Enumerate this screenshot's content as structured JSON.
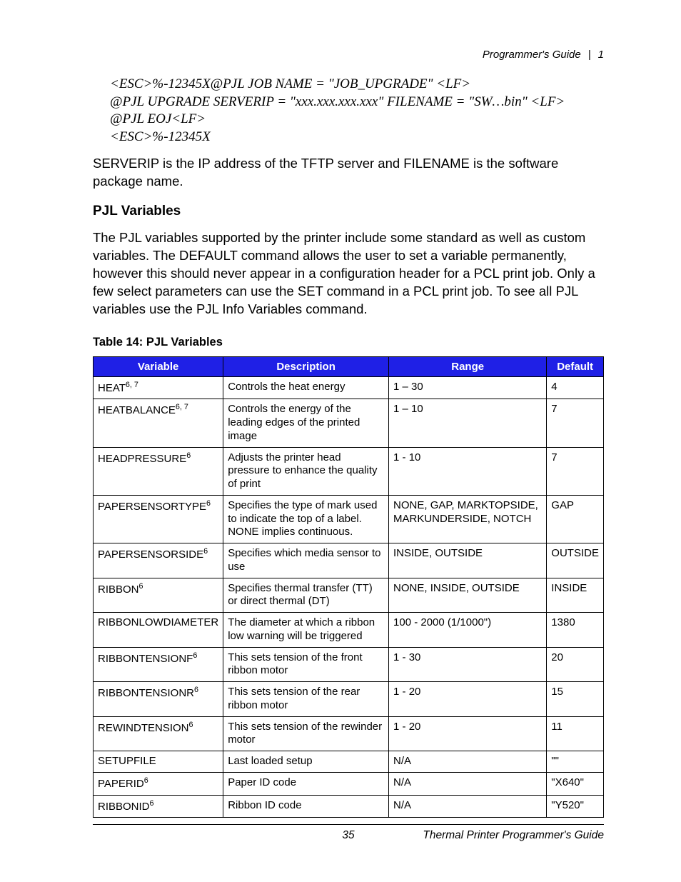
{
  "header": {
    "title": "Programmer's Guide",
    "page_section": "1"
  },
  "code_lines": [
    "<ESC>%-12345X@PJL JOB NAME = \"JOB_UPGRADE\" <LF>",
    "@PJL UPGRADE SERVERIP = \"xxx.xxx.xxx.xxx\" FILENAME = \"SW…bin\" <LF>",
    "@PJL EOJ<LF>",
    "<ESC>%-12345X"
  ],
  "para_serverip": "SERVERIP is the IP address of the TFTP server and FILENAME is the software package name.",
  "section_title": "PJL Variables",
  "para_intro": "The PJL variables supported by the printer include some standard as well as custom variables. The DEFAULT command allows the user to set a variable permanently, however this should never appear in a configuration header for a PCL print job. Only a few select parameters can use the SET command in a PCL print job. To see all PJL variables use the PJL Info Variables command.",
  "table_title": "Table 14: PJL Variables",
  "table": {
    "headers": [
      "Variable",
      "Description",
      "Range",
      "Default"
    ],
    "rows": [
      {
        "variable": "HEAT",
        "sup": "6, 7",
        "description": "Controls the heat energy",
        "range": "1 – 30",
        "default": "4"
      },
      {
        "variable": "HEATBALANCE",
        "sup": "6, 7",
        "description": "Controls the energy of the leading edges of the printed image",
        "range": "1 – 10",
        "default": "7"
      },
      {
        "variable": "HEADPRESSURE",
        "sup": "6",
        "description": "Adjusts the printer head pressure to enhance the quality of print",
        "range": "1 - 10",
        "default": "7"
      },
      {
        "variable": "PAPERSENSORTYPE",
        "sup": "6",
        "description": "Specifies the type of mark used to indicate the top of a label. NONE implies continuous.",
        "range": "NONE, GAP, MARKTOPSIDE, MARKUNDERSIDE, NOTCH",
        "default": "GAP"
      },
      {
        "variable": "PAPERSENSORSIDE",
        "sup": "6",
        "description": "Specifies which media sensor to use",
        "range": "INSIDE, OUTSIDE",
        "default": "OUTSIDE"
      },
      {
        "variable": "RIBBON",
        "sup": "6",
        "description": "Specifies thermal transfer (TT) or direct thermal (DT)",
        "range": "NONE, INSIDE, OUTSIDE",
        "default": "INSIDE"
      },
      {
        "variable": "RIBBONLOWDIAMETER",
        "sup": "",
        "description": "The diameter at which a ribbon low warning will be triggered",
        "range": "100 - 2000  (1/1000\")",
        "default": "1380"
      },
      {
        "variable": "RIBBONTENSIONF",
        "sup": "6",
        "description": "This sets tension of the front ribbon motor",
        "range": "1 - 30",
        "default": "20"
      },
      {
        "variable": "RIBBONTENSIONR",
        "sup": "6",
        "description": "This sets tension of the rear ribbon motor",
        "range": "1 - 20",
        "default": "15"
      },
      {
        "variable": "REWINDTENSION",
        "sup": "6",
        "description": "This sets tension of the rewinder motor",
        "range": "1 - 20",
        "default": "11"
      },
      {
        "variable": "SETUPFILE",
        "sup": "",
        "description": "Last loaded setup",
        "range": "N/A",
        "default": "\"\""
      },
      {
        "variable": "PAPERID",
        "sup": "6",
        "description": "Paper ID code",
        "range": "N/A",
        "default": "\"X640\""
      },
      {
        "variable": "RIBBONID",
        "sup": "6",
        "description": "Ribbon ID code",
        "range": "N/A",
        "default": "\"Y520\""
      }
    ]
  },
  "footer": {
    "page_number": "35",
    "doc_title": "Thermal Printer Programmer's Guide"
  }
}
